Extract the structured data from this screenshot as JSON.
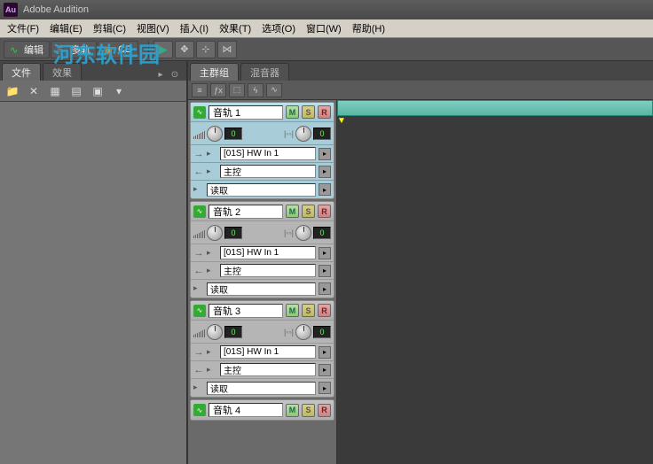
{
  "app": {
    "title": "Adobe Audition",
    "icon_text": "Au"
  },
  "watermark": "河东软件园",
  "menu": [
    "文件(F)",
    "编辑(E)",
    "剪辑(C)",
    "视图(V)",
    "插入(I)",
    "效果(T)",
    "选项(O)",
    "窗口(W)",
    "帮助(H)"
  ],
  "toolbar_modes": {
    "edit": "编辑",
    "multitrack": "多轨",
    "cd": "CD"
  },
  "left_tabs": {
    "files": "文件",
    "effects": "效果"
  },
  "right_tabs": {
    "main": "主群组",
    "mixer": "混音器"
  },
  "tracks": [
    {
      "name": "音轨 1",
      "vol": "0",
      "pan": "0",
      "input": "[01S] HW In 1",
      "output": "主控",
      "mode": "读取",
      "active": true
    },
    {
      "name": "音轨 2",
      "vol": "0",
      "pan": "0",
      "input": "[01S] HW In 1",
      "output": "主控",
      "mode": "读取",
      "active": false
    },
    {
      "name": "音轨 3",
      "vol": "0",
      "pan": "0",
      "input": "[01S] HW In 1",
      "output": "主控",
      "mode": "读取",
      "active": false
    },
    {
      "name": "音轨 4",
      "vol": "",
      "pan": "",
      "input": "",
      "output": "",
      "mode": "",
      "active": false
    }
  ],
  "msr": {
    "m": "M",
    "s": "S",
    "r": "R"
  }
}
